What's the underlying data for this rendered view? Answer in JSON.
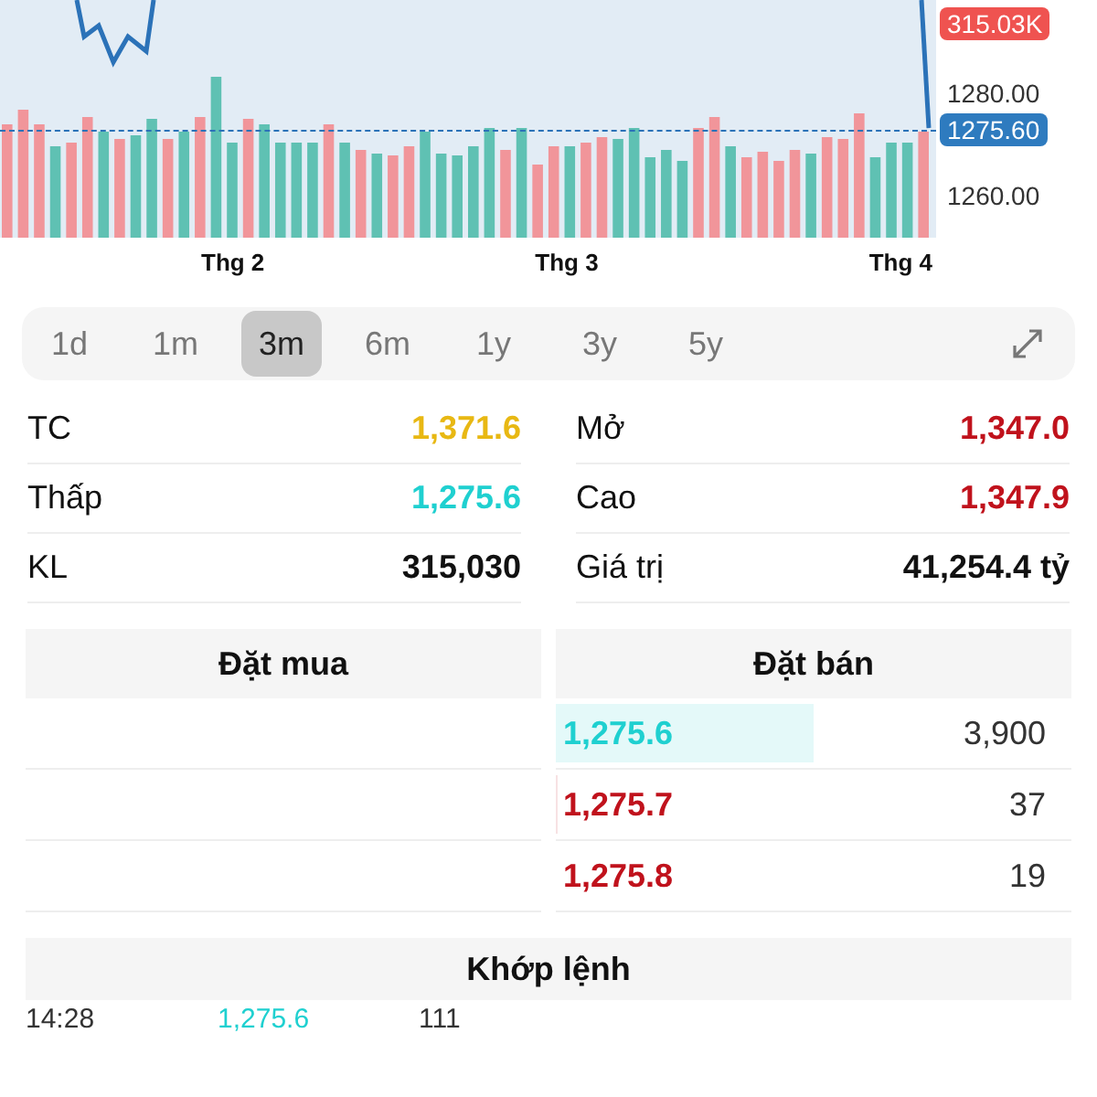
{
  "chart": {
    "axis_labels": [
      {
        "text": "315.03K",
        "kind": "volume_tag"
      },
      {
        "text": "1280.00",
        "kind": "plain"
      },
      {
        "text": "1275.60",
        "kind": "price_tag"
      },
      {
        "text": "1260.00",
        "kind": "plain"
      }
    ],
    "x_labels": [
      "Thg 2",
      "Thg 3",
      "Thg 4"
    ]
  },
  "periods": [
    {
      "label": "1d",
      "selected": false
    },
    {
      "label": "1m",
      "selected": false
    },
    {
      "label": "3m",
      "selected": true
    },
    {
      "label": "6m",
      "selected": false
    },
    {
      "label": "1y",
      "selected": false
    },
    {
      "label": "3y",
      "selected": false
    },
    {
      "label": "5y",
      "selected": false
    }
  ],
  "stats": [
    {
      "label": "TC",
      "value": "1,371.6",
      "color": "#e8b813"
    },
    {
      "label": "Mở",
      "value": "1,347.0",
      "color": "#c0121c"
    },
    {
      "label": "Thấp",
      "value": "1,275.6",
      "color": "#1fd0d0"
    },
    {
      "label": "Cao",
      "value": "1,347.9",
      "color": "#c0121c"
    },
    {
      "label": "KL",
      "value": "315,030",
      "color": "#111111"
    },
    {
      "label": "Giá trị",
      "value": "41,254.4 tỷ",
      "color": "#111111"
    }
  ],
  "order_book": {
    "bid_title": "Đặt mua",
    "ask_title": "Đặt bán",
    "asks": [
      {
        "price": "1,275.6",
        "volume": "3,900",
        "color": "#1fd0d0",
        "level": 0.5
      },
      {
        "price": "1,275.7",
        "volume": "37",
        "color": "#c0121c",
        "level": 0.005
      },
      {
        "price": "1,275.8",
        "volume": "19",
        "color": "#c0121c"
      }
    ]
  },
  "matches": {
    "title": "Khớp lệnh",
    "rows": [
      {
        "time": "14:28",
        "price": "1,275.6",
        "volume": "111",
        "color": "#1fd0d0"
      }
    ]
  }
}
